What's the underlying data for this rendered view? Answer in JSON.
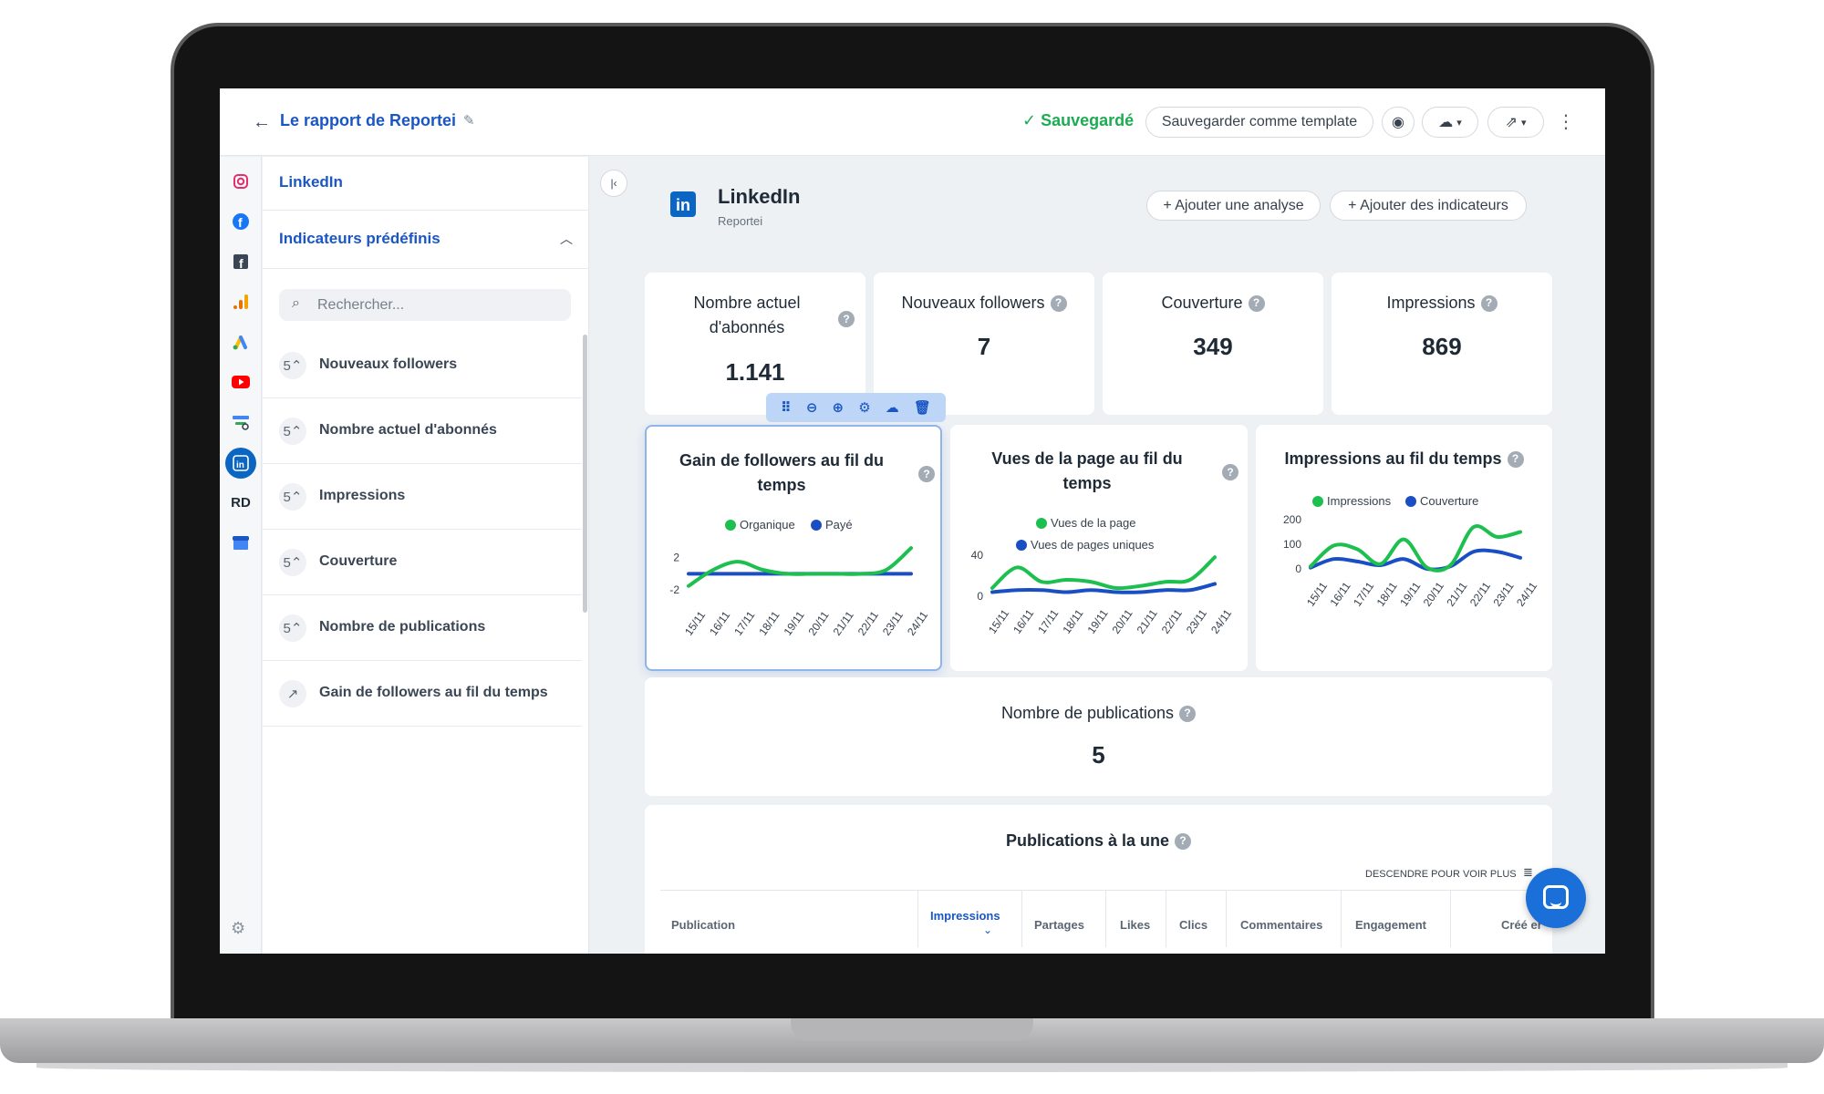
{
  "header": {
    "report_title": "Le rapport de Reportei",
    "saved_label": "✓ Sauvegardé",
    "save_template_label": "Sauvegarder comme template"
  },
  "sidebar": {
    "title": "LinkedIn",
    "section_label": "Indicateurs prédéfinis",
    "search_placeholder": "Rechercher...",
    "items": [
      {
        "label": "Nouveaux followers",
        "icon": "5⌃"
      },
      {
        "label": "Nombre actuel d'abonnés",
        "icon": "5⌃"
      },
      {
        "label": "Impressions",
        "icon": "5⌃"
      },
      {
        "label": "Couverture",
        "icon": "5⌃"
      },
      {
        "label": "Nombre de publications",
        "icon": "5⌃"
      },
      {
        "label": "Gain de followers au fil du temps",
        "icon": "↗"
      }
    ]
  },
  "rail": {
    "rd_label": "RD",
    "colors": {
      "instagram": "#e1306c",
      "facebook": "#1877f2",
      "analytics": "#f4a300",
      "youtube": "#ff0000",
      "linkedin": "#0a66c2"
    }
  },
  "main": {
    "title": "LinkedIn",
    "subtitle": "Reportei",
    "add_analysis_label": "+ Ajouter une analyse",
    "add_indicators_label": "+ Ajouter des indicateurs"
  },
  "kpis": [
    {
      "label": "Nombre actuel d'abonnés",
      "value": "1.141"
    },
    {
      "label": "Nouveaux followers",
      "value": "7"
    },
    {
      "label": "Couverture",
      "value": "349"
    },
    {
      "label": "Impressions",
      "value": "869"
    }
  ],
  "publications": {
    "label": "Nombre de publications",
    "value": "5"
  },
  "featured": {
    "title": "Publications à la une",
    "scroll_hint": "DESCENDRE POUR VOIR PLUS",
    "columns": [
      "Publication",
      "Impressions",
      "Partages",
      "Likes",
      "Clics",
      "Commentaires",
      "Engagement",
      "Créé er"
    ]
  },
  "chart_data": [
    {
      "type": "line",
      "title": "Gain de followers au fil du temps",
      "x": [
        "15/11",
        "16/11",
        "17/11",
        "18/11",
        "19/11",
        "20/11",
        "21/11",
        "22/11",
        "23/11",
        "24/11"
      ],
      "yticks": [
        2,
        -2
      ],
      "series": [
        {
          "name": "Organique",
          "color": "#1dbf4f",
          "values": [
            -1.5,
            0.5,
            1.5,
            0.5,
            0,
            0,
            0,
            0,
            0.5,
            3.2
          ]
        },
        {
          "name": "Payé",
          "color": "#1a4fc4",
          "values": [
            0,
            0,
            0,
            0,
            0,
            0,
            0,
            0,
            0,
            0
          ]
        }
      ],
      "ylim": [
        -3,
        4
      ]
    },
    {
      "type": "line",
      "title": "Vues de la page au fil du temps",
      "x": [
        "15/11",
        "16/11",
        "17/11",
        "18/11",
        "19/11",
        "20/11",
        "21/11",
        "22/11",
        "23/11",
        "24/11"
      ],
      "yticks": [
        40,
        0
      ],
      "series": [
        {
          "name": "Vues de la page",
          "color": "#1dbf4f",
          "values": [
            8,
            28,
            14,
            16,
            14,
            8,
            10,
            14,
            16,
            38
          ]
        },
        {
          "name": "Vues de pages uniques",
          "color": "#1a4fc4",
          "values": [
            4,
            6,
            6,
            4,
            6,
            4,
            4,
            6,
            6,
            12
          ]
        }
      ],
      "ylim": [
        0,
        55
      ]
    },
    {
      "type": "line",
      "title": "Impressions au fil du temps",
      "x": [
        "15/11",
        "16/11",
        "17/11",
        "18/11",
        "19/11",
        "20/11",
        "21/11",
        "22/11",
        "23/11",
        "24/11"
      ],
      "yticks": [
        200,
        100,
        0
      ],
      "series": [
        {
          "name": "Impressions",
          "color": "#1dbf4f",
          "values": [
            10,
            95,
            80,
            20,
            120,
            5,
            15,
            170,
            130,
            150
          ]
        },
        {
          "name": "Couverture",
          "color": "#1a4fc4",
          "values": [
            5,
            40,
            30,
            15,
            40,
            0,
            10,
            70,
            70,
            45
          ]
        }
      ],
      "ylim": [
        0,
        200
      ]
    }
  ]
}
